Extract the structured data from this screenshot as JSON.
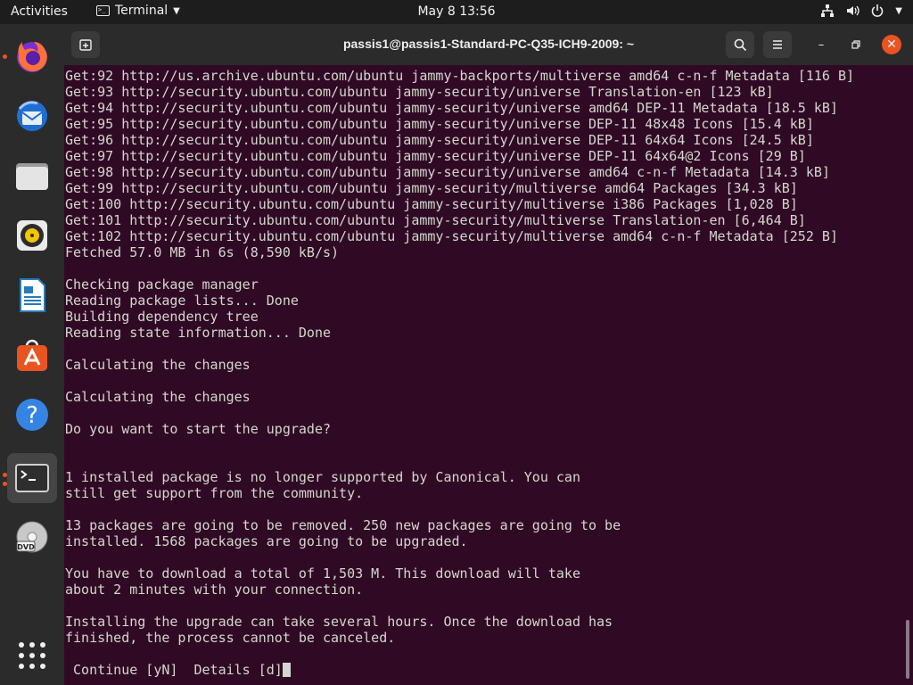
{
  "topbar": {
    "activities": "Activities",
    "app_name": "Terminal",
    "clock": "May 8  13:56"
  },
  "dock": {
    "items": [
      "Firefox",
      "Thunderbird",
      "Files",
      "Rhythmbox",
      "LibreOffice Writer",
      "Ubuntu Software",
      "Help",
      "Terminal",
      "DVD"
    ]
  },
  "window": {
    "title": "passis1@passis1-Standard-PC-Q35-ICH9-2009: ~"
  },
  "terminal": {
    "lines": [
      "Get:92 http://us.archive.ubuntu.com/ubuntu jammy-backports/multiverse amd64 c-n-f Metadata [116 B]",
      "Get:93 http://security.ubuntu.com/ubuntu jammy-security/universe Translation-en [123 kB]",
      "Get:94 http://security.ubuntu.com/ubuntu jammy-security/universe amd64 DEP-11 Metadata [18.5 kB]",
      "Get:95 http://security.ubuntu.com/ubuntu jammy-security/universe DEP-11 48x48 Icons [15.4 kB]",
      "Get:96 http://security.ubuntu.com/ubuntu jammy-security/universe DEP-11 64x64 Icons [24.5 kB]",
      "Get:97 http://security.ubuntu.com/ubuntu jammy-security/universe DEP-11 64x64@2 Icons [29 B]",
      "Get:98 http://security.ubuntu.com/ubuntu jammy-security/universe amd64 c-n-f Metadata [14.3 kB]",
      "Get:99 http://security.ubuntu.com/ubuntu jammy-security/multiverse amd64 Packages [34.3 kB]",
      "Get:100 http://security.ubuntu.com/ubuntu jammy-security/multiverse i386 Packages [1,028 B]",
      "Get:101 http://security.ubuntu.com/ubuntu jammy-security/multiverse Translation-en [6,464 B]",
      "Get:102 http://security.ubuntu.com/ubuntu jammy-security/multiverse amd64 c-n-f Metadata [252 B]",
      "Fetched 57.0 MB in 6s (8,590 kB/s)",
      "",
      "Checking package manager",
      "Reading package lists... Done",
      "Building dependency tree",
      "Reading state information... Done",
      "",
      "Calculating the changes",
      "",
      "Calculating the changes",
      "",
      "Do you want to start the upgrade?",
      "",
      "",
      "1 installed package is no longer supported by Canonical. You can",
      "still get support from the community.",
      "",
      "13 packages are going to be removed. 250 new packages are going to be",
      "installed. 1568 packages are going to be upgraded.",
      "",
      "You have to download a total of 1,503 M. This download will take",
      "about 2 minutes with your connection.",
      "",
      "Installing the upgrade can take several hours. Once the download has",
      "finished, the process cannot be canceled.",
      "",
      " Continue [yN]  Details [d]"
    ]
  }
}
